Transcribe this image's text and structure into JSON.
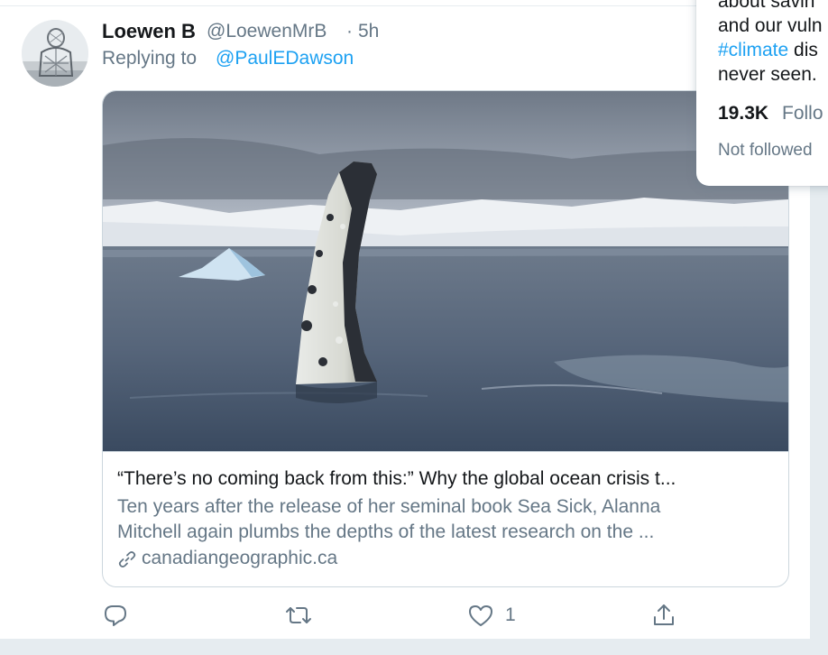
{
  "tweet": {
    "author_name": "Loewen B",
    "author_handle": "@LoewenMrB",
    "separator": "·",
    "time": "5h",
    "replying_prefix": "Replying to",
    "replying_to": "@PaulEDawson",
    "avatar_icon": "sculpture-avatar-icon"
  },
  "link_card": {
    "title": "“There’s no coming back from this:” Why the global ocean crisis t...",
    "description_line1": "Ten years after the release of her seminal book Sea Sick, Alanna",
    "description_line2": "Mitchell again plumbs the depths of the latest research on the ...",
    "domain": "canadiangeographic.ca",
    "link_icon": "link-icon"
  },
  "actions": {
    "reply_icon": "reply-icon",
    "retweet_icon": "retweet-icon",
    "like_icon": "heart-icon",
    "like_count": "1",
    "share_icon": "share-icon"
  },
  "hover_card": {
    "line1": "about savin",
    "line2": "and our vuln",
    "hashtag": "#climate",
    "line3_rest": " dis",
    "line4": "never seen.",
    "followers_count": "19.3K",
    "followers_label": "Follo",
    "follow_status": "Not followed"
  },
  "colors": {
    "accent": "#1da1f2",
    "secondary_text": "#657786",
    "border": "#ccd6dd",
    "background": "#e6ecf0"
  }
}
